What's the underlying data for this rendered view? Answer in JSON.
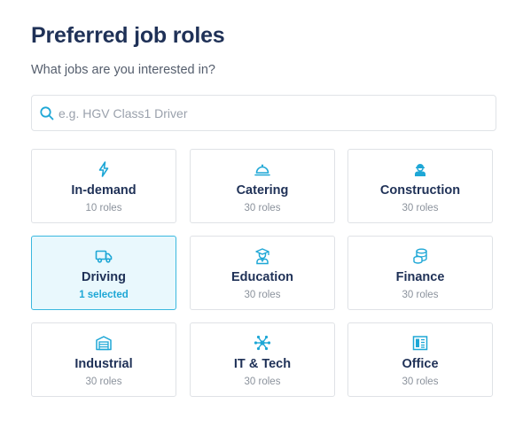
{
  "header": {
    "title": "Preferred job roles",
    "subtitle": "What jobs are you interested in?"
  },
  "search": {
    "placeholder": "e.g. HGV Class1 Driver",
    "value": "",
    "icon": "search-icon"
  },
  "colors": {
    "accent": "#1ea7d6",
    "title": "#1f3157",
    "selected_bg": "#e9f8fd"
  },
  "categories": [
    {
      "label": "In-demand",
      "meta": "10 roles",
      "icon": "lightning-icon",
      "selected": false
    },
    {
      "label": "Catering",
      "meta": "30 roles",
      "icon": "cloche-icon",
      "selected": false
    },
    {
      "label": "Construction",
      "meta": "30 roles",
      "icon": "construction-worker-icon",
      "selected": false
    },
    {
      "label": "Driving",
      "meta": "1 selected",
      "icon": "truck-icon",
      "selected": true
    },
    {
      "label": "Education",
      "meta": "30 roles",
      "icon": "graduate-icon",
      "selected": false
    },
    {
      "label": "Finance",
      "meta": "30 roles",
      "icon": "coins-icon",
      "selected": false
    },
    {
      "label": "Industrial",
      "meta": "30 roles",
      "icon": "warehouse-icon",
      "selected": false
    },
    {
      "label": "IT & Tech",
      "meta": "30 roles",
      "icon": "network-icon",
      "selected": false
    },
    {
      "label": "Office",
      "meta": "30 roles",
      "icon": "office-building-icon",
      "selected": false
    }
  ]
}
